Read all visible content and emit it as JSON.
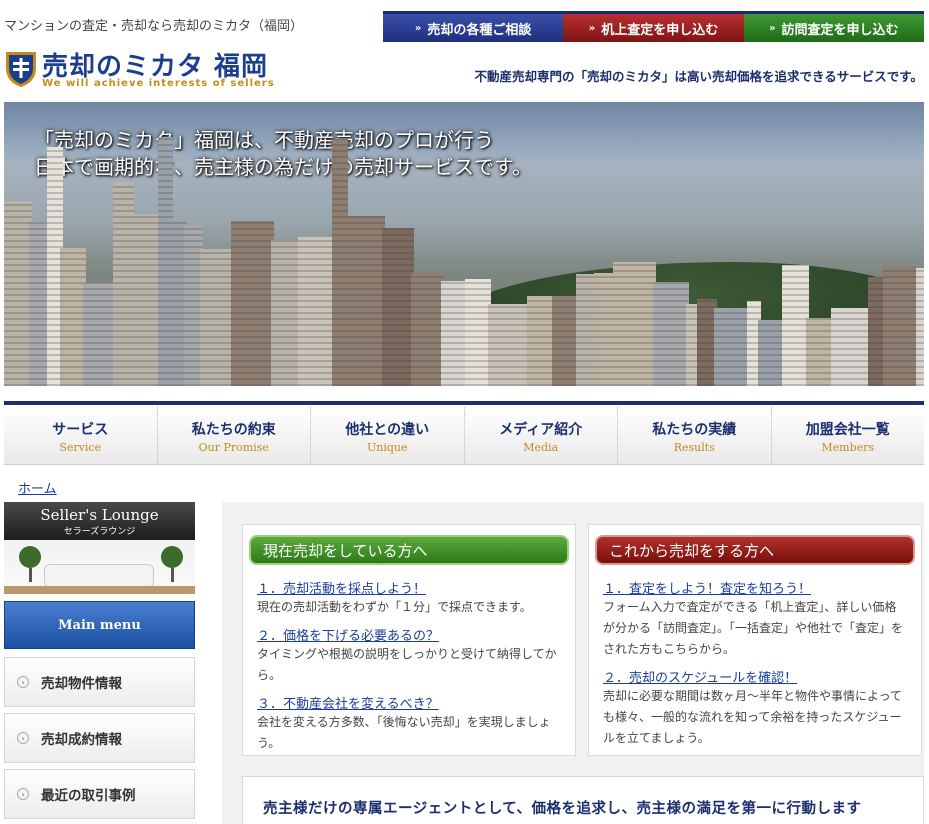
{
  "header": {
    "tagline": "マンションの査定・売却なら売却のミカタ（福岡）",
    "top_buttons": [
      {
        "label": "売却の各種ご相談",
        "color": "#2a3d92"
      },
      {
        "label": "机上査定を申し込む",
        "color": "#9a2220"
      },
      {
        "label": "訪問査定を申し込む",
        "color": "#2f8226"
      }
    ],
    "logo_text": "売却のミカタ 福岡",
    "logo_sub": "We will achieve interests of sellers",
    "headline": "不動産売却専門の「売却のミカタ」は高い売却価格を追求できるサービスです。"
  },
  "hero": {
    "line1": "「売却のミカタ」福岡は、不動産売却のプロが行う",
    "line2": "日本で画期的な、売主様の為だけの売却サービスです。"
  },
  "nav": [
    {
      "jp": "サービス",
      "en": "Service"
    },
    {
      "jp": "私たちの約束",
      "en": "Our Promise"
    },
    {
      "jp": "他社との違い",
      "en": "Unique"
    },
    {
      "jp": "メディア紹介",
      "en": "Media"
    },
    {
      "jp": "私たちの実績",
      "en": "Results"
    },
    {
      "jp": "加盟会社一覧",
      "en": "Members"
    }
  ],
  "breadcrumb": "ホーム",
  "sidebar": {
    "lounge_title": "Seller's Lounge",
    "lounge_sub": "セラーズラウンジ",
    "main_menu": "Main menu",
    "items": [
      "売却物件情報",
      "売却成約情報",
      "最近の取引事例"
    ]
  },
  "current_sellers": {
    "title": "現在売却をしている方へ",
    "entries": [
      {
        "link": "１．売却活動を採点しよう！",
        "desc": "現在の売却活動をわずか「１分」で採点できます。"
      },
      {
        "link": "２．価格を下げる必要あるの？",
        "desc": "タイミングや根拠の説明をしっかりと受けて納得してから。"
      },
      {
        "link": "３．不動産会社を変えるべき？",
        "desc": "会社を変える方多数、「後悔ない売却」を実現しましょう。"
      }
    ]
  },
  "future_sellers": {
    "title": "これから売却をする方へ",
    "entries": [
      {
        "link": "１．査定をしよう！査定を知ろう！",
        "desc": "フォーム入力で査定ができる「机上査定」、詳しい価格が分かる「訪問査定」。「一括査定」や他社で「査定」をされた方もこちらから。"
      },
      {
        "link": "２．売却のスケジュールを確認！",
        "desc": "売却に必要な期間は数ヶ月〜半年と物件や事情によっても様々、一般的な流れを知って余裕を持ったスケジュールを立てましょう。"
      }
    ]
  },
  "banner": "売主様だけの専属エージェントとして、価格を追求し、売主様の満足を第一に行動します"
}
